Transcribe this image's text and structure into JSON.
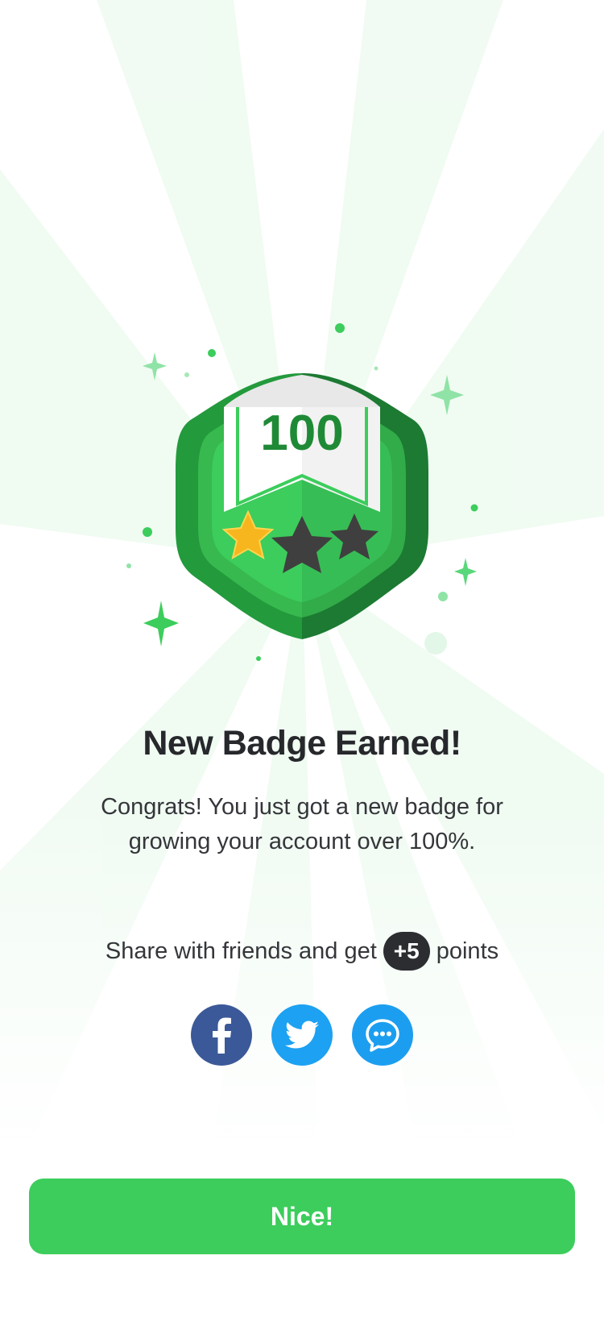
{
  "badge": {
    "number": "100",
    "stars_total": 3,
    "stars_earned": 1
  },
  "title": "New Badge Earned!",
  "description": "Congrats! You just got a new badge for growing your account over 100%.",
  "share": {
    "prefix": "Share with friends and get",
    "points": "+5",
    "suffix": "points"
  },
  "social": [
    {
      "name": "facebook",
      "icon": "facebook-icon",
      "color": "#3b5998"
    },
    {
      "name": "twitter",
      "icon": "twitter-icon",
      "color": "#1da1f2"
    },
    {
      "name": "message",
      "icon": "chat-bubble-icon",
      "color": "#1c9ef0"
    }
  ],
  "cta": {
    "label": "Nice!"
  },
  "colors": {
    "accent": "#3ccd5c",
    "badge_dark": "#1c7a32",
    "text_dark": "#26282c",
    "pill_dark": "#2b2d31"
  }
}
